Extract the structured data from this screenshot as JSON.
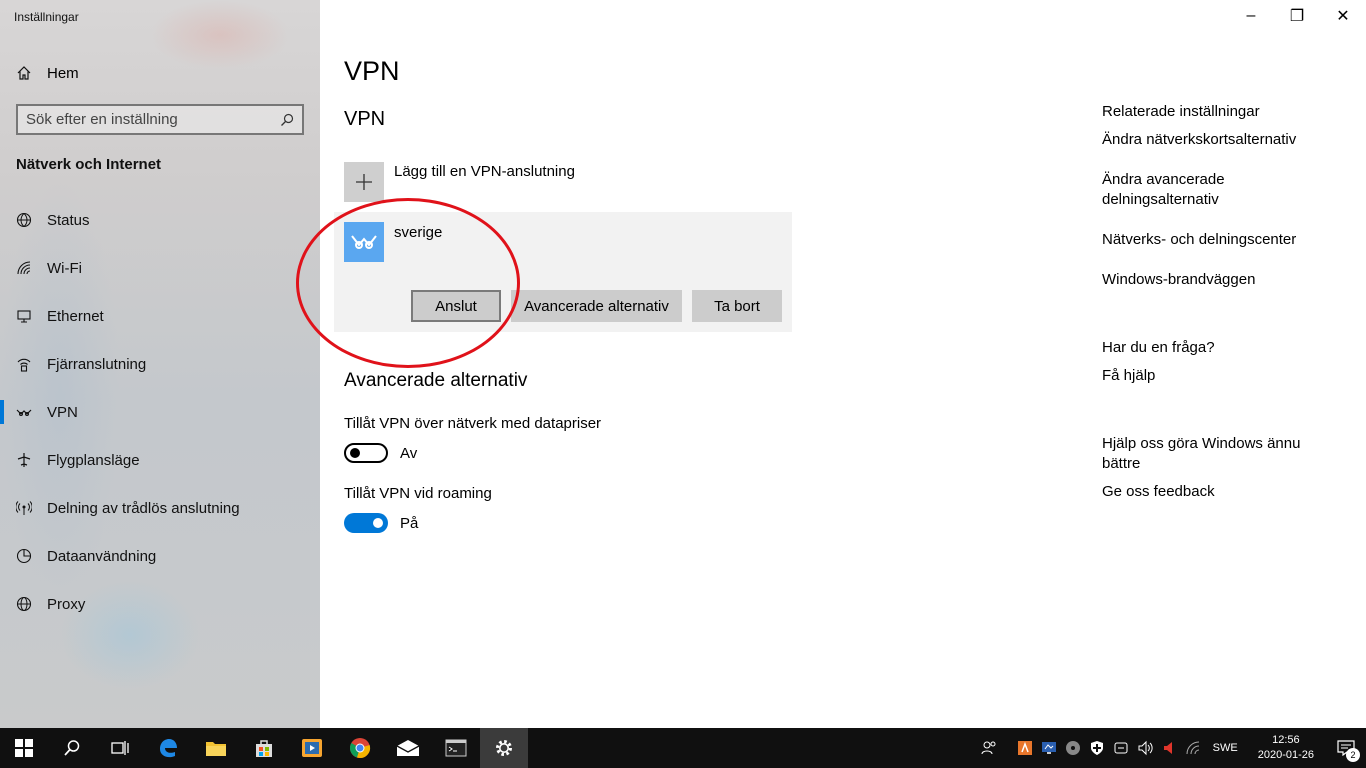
{
  "window": {
    "title": "Inställningar",
    "minimize": "–",
    "restore": "❐",
    "close": "✕"
  },
  "sidebar": {
    "home": "Hem",
    "search_placeholder": "Sök efter en inställning",
    "section": "Nätverk och Internet",
    "items": [
      {
        "label": "Status",
        "icon": "status-icon",
        "active": false
      },
      {
        "label": "Wi-Fi",
        "icon": "wifi-icon",
        "active": false
      },
      {
        "label": "Ethernet",
        "icon": "ethernet-icon",
        "active": false
      },
      {
        "label": "Fjärranslutning",
        "icon": "dialup-icon",
        "active": false
      },
      {
        "label": "VPN",
        "icon": "vpn-icon",
        "active": true
      },
      {
        "label": "Flygplansläge",
        "icon": "airplane-icon",
        "active": false
      },
      {
        "label": "Delning av trådlös anslutning",
        "icon": "hotspot-icon",
        "active": false
      },
      {
        "label": "Dataanvändning",
        "icon": "data-usage-icon",
        "active": false
      },
      {
        "label": "Proxy",
        "icon": "globe-icon",
        "active": false
      }
    ]
  },
  "main": {
    "page_title": "VPN",
    "vpn_heading": "VPN",
    "add_vpn": "Lägg till en VPN-anslutning",
    "connection": {
      "name": "sverige",
      "connect": "Anslut",
      "advanced": "Avancerade alternativ",
      "remove": "Ta bort"
    },
    "advanced_heading": "Avancerade alternativ",
    "metered": {
      "label": "Tillåt VPN över nätverk med datapriser",
      "state": "Av",
      "on": false
    },
    "roaming": {
      "label": "Tillåt VPN vid roaming",
      "state": "På",
      "on": true
    }
  },
  "right": {
    "related_heading": "Relaterade inställningar",
    "links": [
      "Ändra nätverkskortsalternativ",
      "Ändra avancerade delningsalternativ",
      "Nätverks- och delningscenter",
      "Windows-brandväggen"
    ],
    "question_heading": "Har du en fråga?",
    "help_link": "Få hjälp",
    "improve_heading": "Hjälp oss göra Windows ännu bättre",
    "feedback_link": "Ge oss feedback"
  },
  "taskbar": {
    "lang": "SWE",
    "time": "12:56",
    "date": "2020-01-26",
    "notifications": "2"
  },
  "colors": {
    "accent": "#0078d7",
    "link": "#0067c0",
    "annotation": "#e0121a"
  }
}
